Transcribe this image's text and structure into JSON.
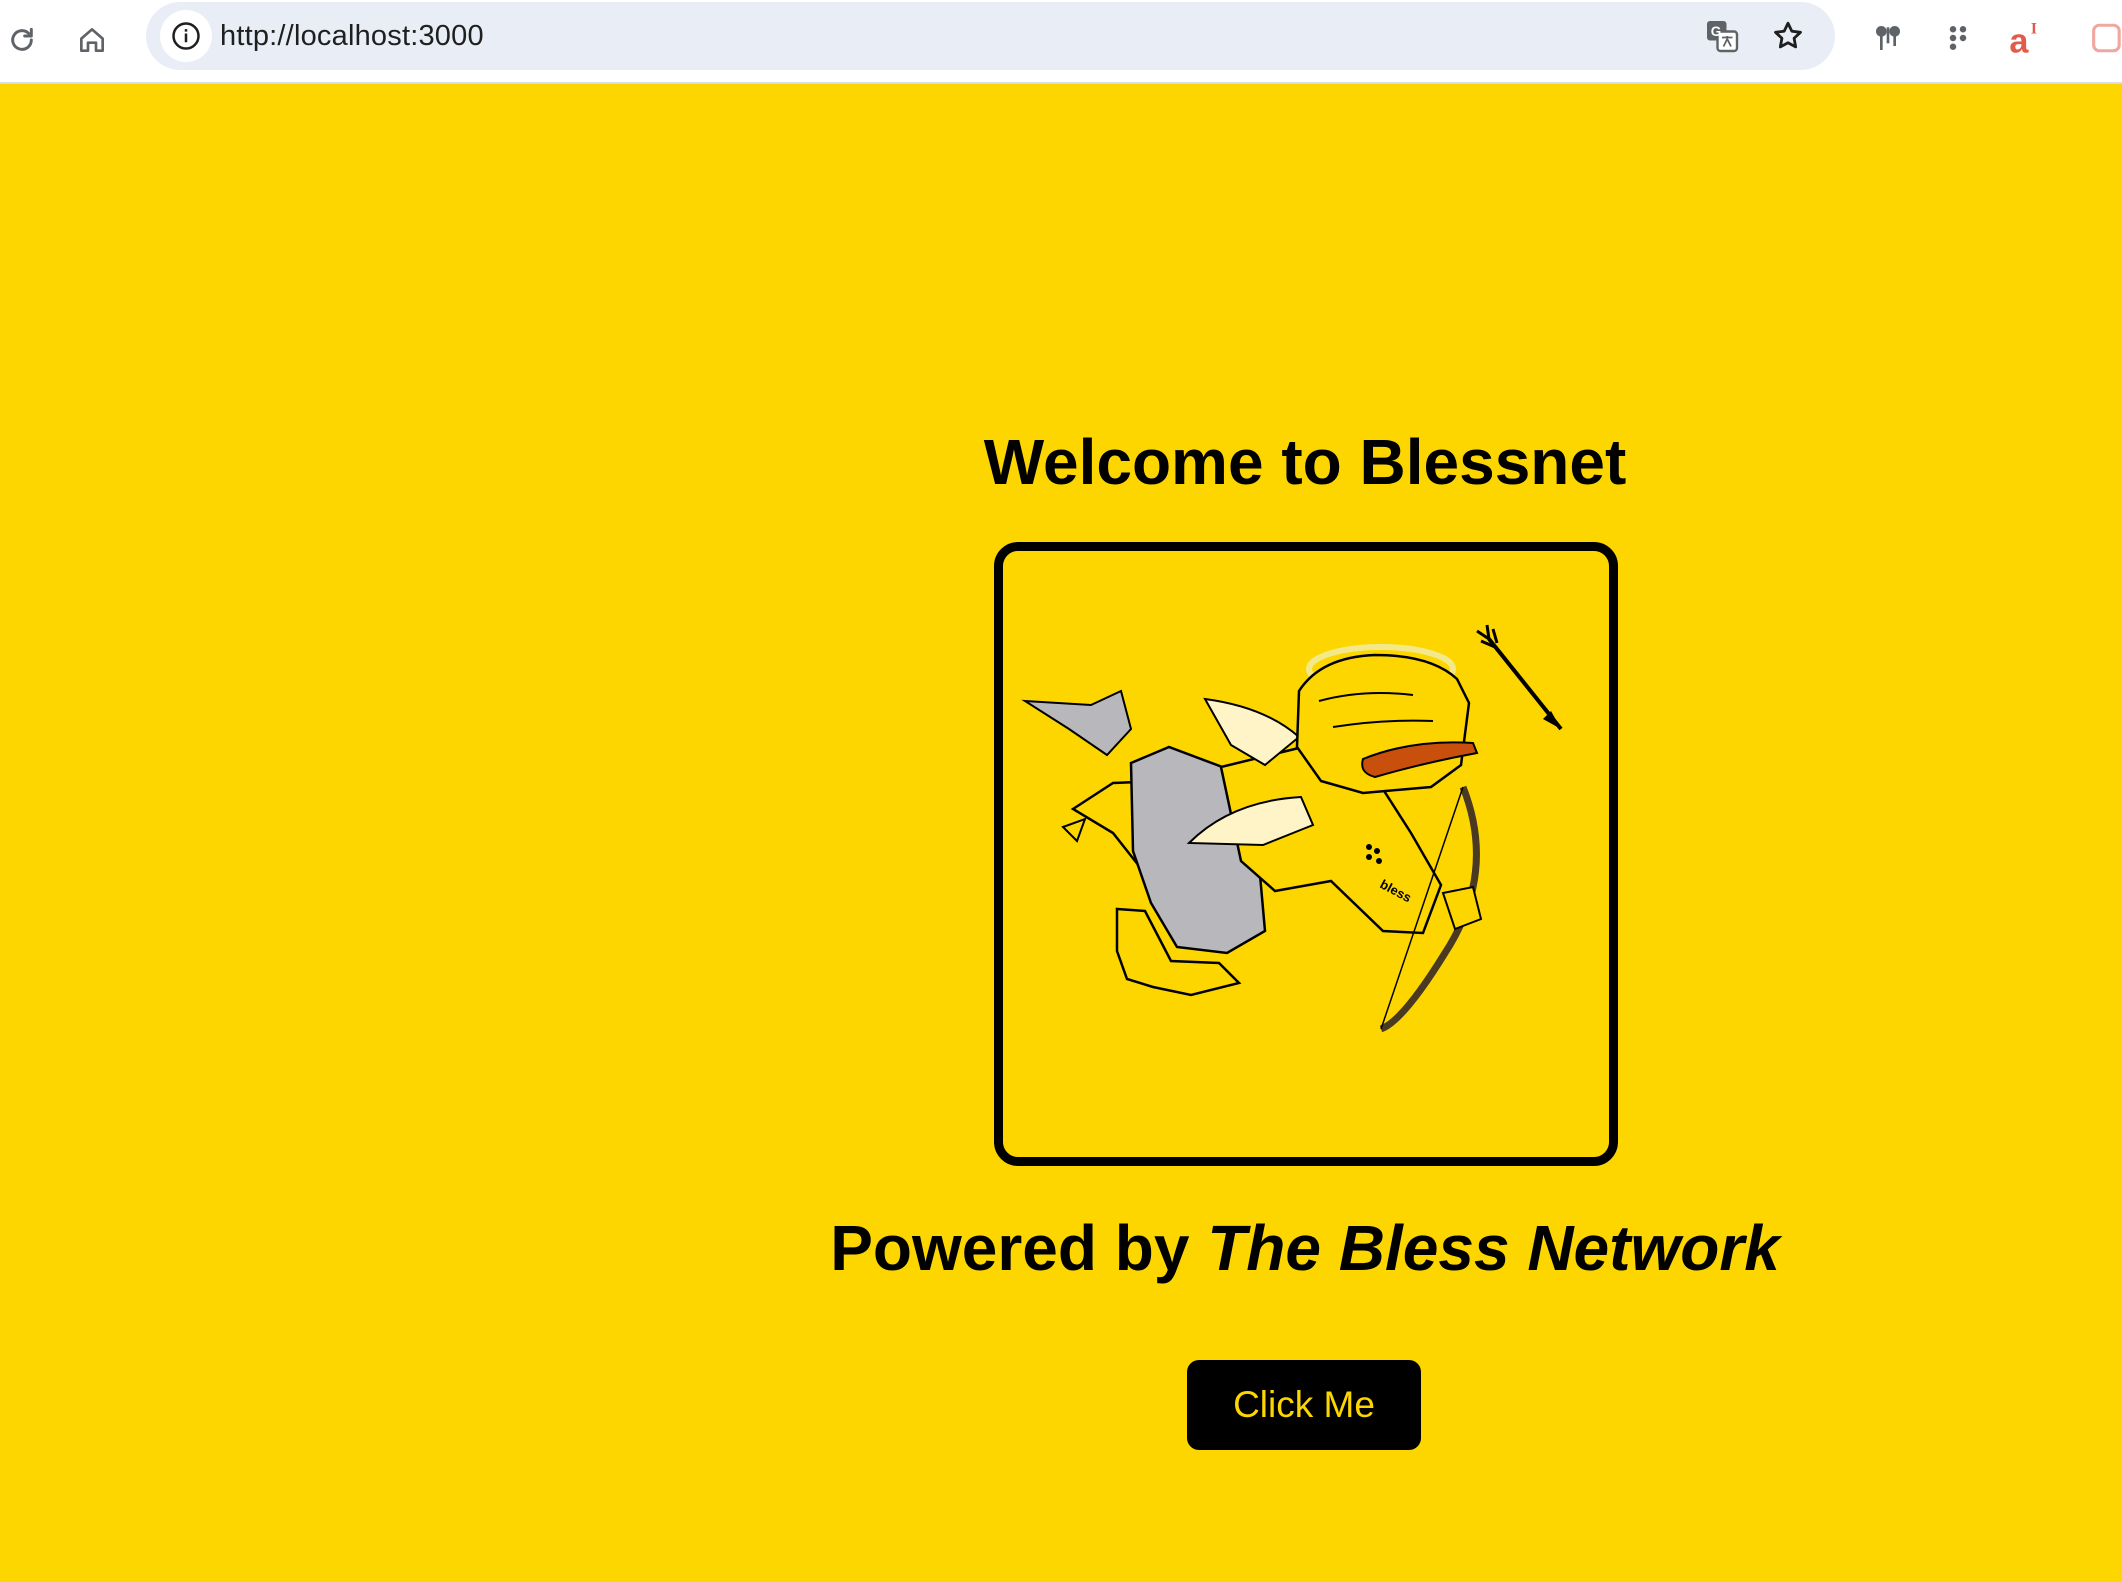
{
  "browser": {
    "url": "http://localhost:3000"
  },
  "page": {
    "title": "Welcome to Blessnet",
    "powered_prefix": "Powered by",
    "powered_brand": "The Bless Network",
    "button_label": "Click Me",
    "image_text": "bless"
  },
  "colors": {
    "background": "#FDD600",
    "button_bg": "#000000",
    "button_text": "#FDD600"
  }
}
